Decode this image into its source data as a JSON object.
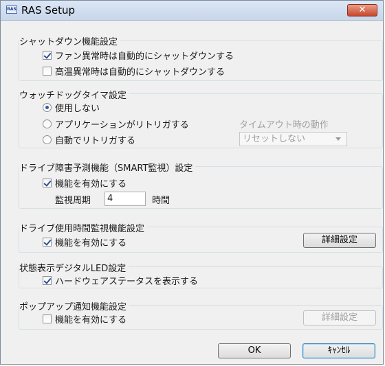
{
  "window": {
    "title": "RAS Setup",
    "icon_text": "RAS",
    "close_symbol": "✕"
  },
  "shutdown": {
    "title": "シャットダウン機能設定",
    "fan_label": "ファン異常時は自動的にシャットダウンする",
    "fan_checked": true,
    "temp_label": "高温異常時は自動的にシャットダウンする",
    "temp_checked": false
  },
  "watchdog": {
    "title": "ウォッチドッグタイマ設定",
    "options": [
      "使用しない",
      "アプリケーションがリトリガする",
      "自動でリトリガする"
    ],
    "selected_index": 0,
    "timeout_label": "タイムアウト時の動作",
    "timeout_value": "リセットしない"
  },
  "smart": {
    "title": "ドライブ障害予測機能（SMART監視）設定",
    "enable_label": "機能を有効にする",
    "enable_checked": true,
    "period_label": "監視周期",
    "period_value": "4",
    "period_unit": "時間"
  },
  "usage": {
    "title": "ドライブ使用時間監視機能設定",
    "enable_label": "機能を有効にする",
    "enable_checked": true,
    "detail_button": "詳細設定"
  },
  "led": {
    "title": "状態表示デジタルLED設定",
    "hw_label": "ハードウェアステータスを表示する",
    "hw_checked": true
  },
  "popup": {
    "title": "ポップアップ通知機能設定",
    "enable_label": "機能を有効にする",
    "enable_checked": false,
    "detail_button": "詳細設定"
  },
  "footer": {
    "ok_label": "OK",
    "cancel_label": "ｷｬﾝｾﾙ"
  }
}
